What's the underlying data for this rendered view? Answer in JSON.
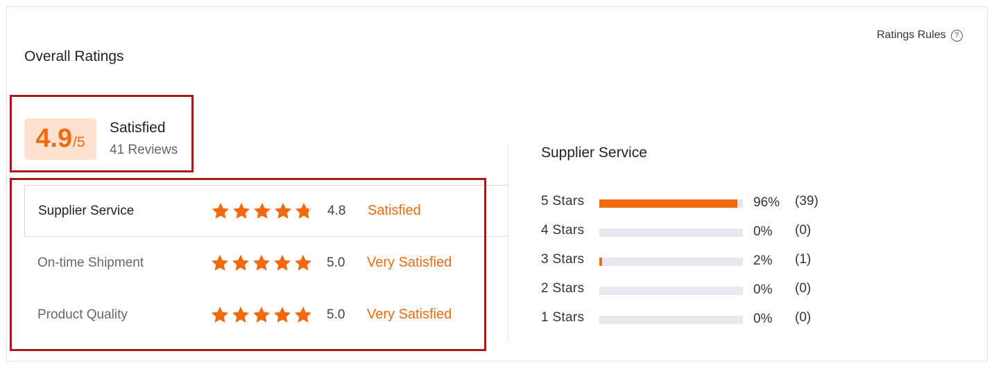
{
  "header": {
    "title": "Overall Ratings",
    "rules_label": "Ratings Rules",
    "rules_icon": "question-circle-icon"
  },
  "summary": {
    "score": "4.9",
    "max": "/5",
    "label": "Satisfied",
    "reviews": "41 Reviews"
  },
  "categories": [
    {
      "label": "Supplier Service",
      "rating": 4.8,
      "score": "4.8",
      "verdict": "Satisfied",
      "active": true
    },
    {
      "label": "On-time Shipment",
      "rating": 5.0,
      "score": "5.0",
      "verdict": "Very Satisfied",
      "active": false
    },
    {
      "label": "Product Quality",
      "rating": 5.0,
      "score": "5.0",
      "verdict": "Very Satisfied",
      "active": false
    }
  ],
  "detail": {
    "title": "Supplier Service",
    "distribution": [
      {
        "label": "5  Stars",
        "percent": 96,
        "pct_text": "96%",
        "count": "(39)"
      },
      {
        "label": "4  Stars",
        "percent": 0,
        "pct_text": "0%",
        "count": "(0)"
      },
      {
        "label": "3  Stars",
        "percent": 2,
        "pct_text": "2%",
        "count": "(1)"
      },
      {
        "label": "2  Stars",
        "percent": 0,
        "pct_text": "0%",
        "count": "(0)"
      },
      {
        "label": "1  Stars",
        "percent": 0,
        "pct_text": "0%",
        "count": "(0)"
      }
    ]
  },
  "colors": {
    "accent": "#f26a10",
    "badge_bg": "#ffe1cf",
    "highlight_border": "#a31d17",
    "bar_track": "#e8e8ee",
    "star_empty": "#d6d6d6"
  }
}
